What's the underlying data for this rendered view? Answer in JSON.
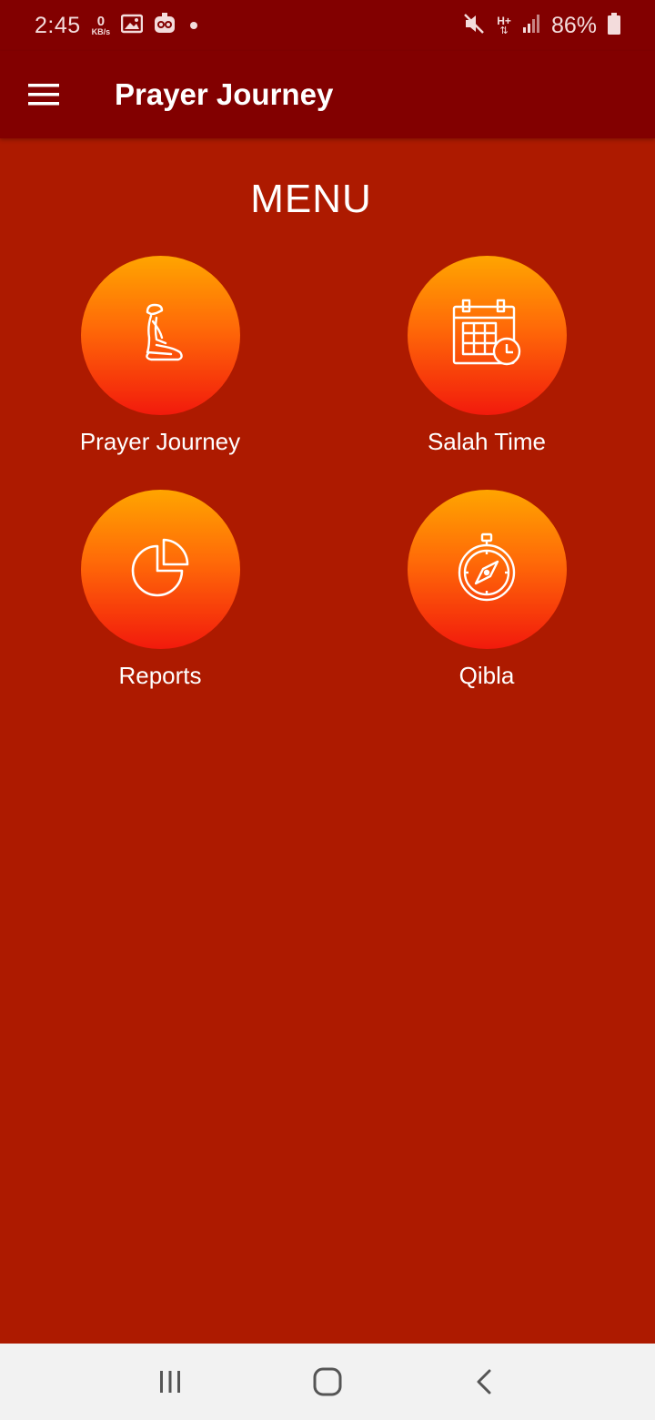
{
  "status_bar": {
    "time": "2:45",
    "net_speed_value": "0",
    "net_speed_unit": "KB/s",
    "network_type": "H+",
    "battery_percent": "86%"
  },
  "app_bar": {
    "title": "Prayer Journey",
    "menu_icon": "hamburger-menu-icon"
  },
  "main": {
    "heading": "MENU",
    "items": [
      {
        "label": "Prayer Journey",
        "icon": "praying-person-icon"
      },
      {
        "label": "Salah Time",
        "icon": "calendar-clock-icon"
      },
      {
        "label": "Reports",
        "icon": "pie-chart-icon"
      },
      {
        "label": "Qibla",
        "icon": "compass-icon"
      }
    ]
  },
  "nav_bar": {
    "buttons": [
      "recent-apps-icon",
      "home-icon",
      "back-icon"
    ]
  },
  "colors": {
    "app_bar": "#820000",
    "background": "#ad1a00",
    "circle_top": "#ffa500",
    "circle_bottom": "#f21a0c",
    "nav_bar": "#f2f2f2"
  }
}
